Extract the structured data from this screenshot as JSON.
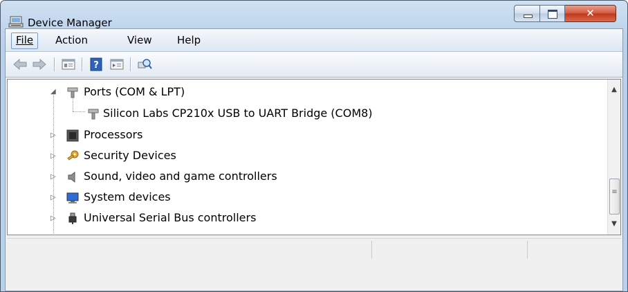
{
  "window": {
    "title": "Device Manager",
    "icon": "device-manager-icon",
    "caption_buttons": [
      "minimize",
      "maximize",
      "close"
    ]
  },
  "menubar": {
    "items": [
      {
        "label": "File",
        "accel": "F"
      },
      {
        "label": "Action",
        "accel": "A"
      },
      {
        "label": "View",
        "accel": "V"
      },
      {
        "label": "Help",
        "accel": "H"
      }
    ]
  },
  "toolbar": {
    "buttons": [
      "back-arrow-icon",
      "forward-arrow-icon",
      "properties-icon",
      "help-icon",
      "update-driver-icon",
      "scan-hardware-icon"
    ]
  },
  "tree": {
    "items": [
      {
        "label": "Ports (COM & LPT)",
        "icon": "port-icon",
        "expanded": true
      },
      {
        "label": "Silicon Labs CP210x USB to UART Bridge (COM8)",
        "icon": "port-icon",
        "child": true
      },
      {
        "label": "Processors",
        "icon": "processor-icon",
        "expanded": false
      },
      {
        "label": "Security Devices",
        "icon": "key-icon",
        "expanded": false
      },
      {
        "label": "Sound, video and game controllers",
        "icon": "speaker-icon",
        "expanded": false
      },
      {
        "label": "System devices",
        "icon": "computer-icon",
        "expanded": false
      },
      {
        "label": "Universal Serial Bus controllers",
        "icon": "usb-plug-icon",
        "expanded": false
      }
    ]
  },
  "colors": {
    "title_bar": "#b9d1ea",
    "close_button": "#c1371a",
    "tree_background": "#ffffff"
  }
}
